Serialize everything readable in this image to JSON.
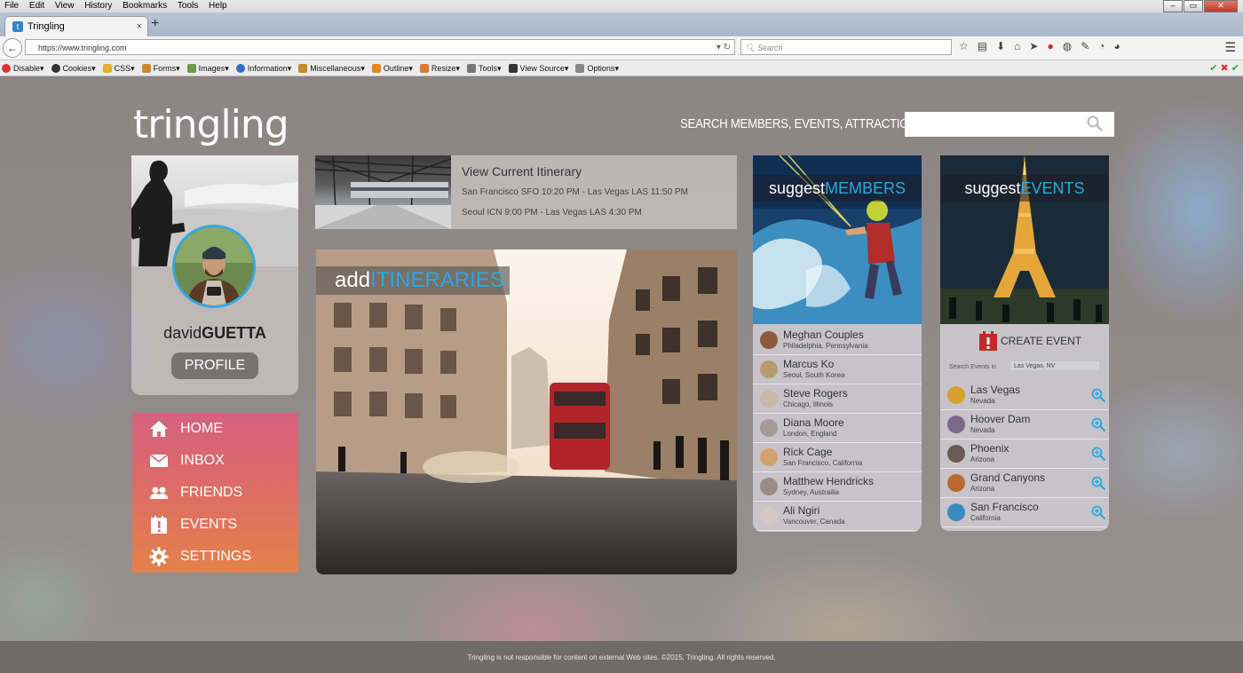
{
  "browser": {
    "menu": [
      "File",
      "Edit",
      "View",
      "History",
      "Bookmarks",
      "Tools",
      "Help"
    ],
    "tab_title": "Tringling",
    "tab_favicon": "t",
    "url": "https://www.tringling.com",
    "search_placeholder": "Search",
    "devbar": [
      "Disable",
      "Cookies",
      "CSS",
      "Forms",
      "Images",
      "Information",
      "Miscellaneous",
      "Outline",
      "Resize",
      "Tools",
      "View Source",
      "Options"
    ]
  },
  "site": {
    "logo": "tringling",
    "search_label": "SEARCH MEMBERS, EVENTS, ATTRACTIONS:",
    "search_value": ""
  },
  "profile": {
    "first": "david",
    "last": "GUETTA",
    "button": "PROFILE"
  },
  "nav": [
    {
      "label": "HOME",
      "icon": "home-icon"
    },
    {
      "label": "INBOX",
      "icon": "envelope-icon"
    },
    {
      "label": "FRIENDS",
      "icon": "friends-icon"
    },
    {
      "label": "EVENTS",
      "icon": "calendar-icon"
    },
    {
      "label": "SETTINGS",
      "icon": "gear-icon"
    }
  ],
  "itinerary": {
    "title": "View Current Itinerary",
    "lines": [
      "San Francisco SFO 10:20 PM - Las Vegas LAS 11:50 PM",
      "Seoul ICN 9:00 PM - Las Vegas LAS 4:30 PM"
    ]
  },
  "hero": {
    "prefix": "add",
    "highlight": "ITINERARIES"
  },
  "suggest_members": {
    "prefix": "suggest",
    "highlight": "MEMBERS",
    "items": [
      {
        "name": "Meghan Couples",
        "location": "Philadelphia, Pennsylvania",
        "color": "#8a5a3a"
      },
      {
        "name": "Marcus Ko",
        "location": "Seoul, South Korea",
        "color": "#b89a70"
      },
      {
        "name": "Steve Rogers",
        "location": "Chicago, Illinois",
        "color": "#c9b8a8"
      },
      {
        "name": "Diana Moore",
        "location": "London, England",
        "color": "#a39b94"
      },
      {
        "name": "Rick Cage",
        "location": "San Francisco, California",
        "color": "#d4a070"
      },
      {
        "name": "Matthew Hendricks",
        "location": "Sydney, Austrailia",
        "color": "#9a8d85"
      },
      {
        "name": "Ali Ngiri",
        "location": "Vancouver, Canada",
        "color": "#d6c8c0"
      }
    ]
  },
  "suggest_events": {
    "prefix": "suggest",
    "highlight": "EVENTS",
    "create_label": "CREATE EVENT",
    "search_label": "Search Events in",
    "search_value": "Las Vegas, NV",
    "items": [
      {
        "name": "Las Vegas",
        "state": "Nevada",
        "color": "#d9a030"
      },
      {
        "name": "Hoover Dam",
        "state": "Nevada",
        "color": "#7b6a8a"
      },
      {
        "name": "Phoenix",
        "state": "Arizona",
        "color": "#6a5a58"
      },
      {
        "name": "Grand Canyons",
        "state": "Arizona",
        "color": "#b86a30"
      },
      {
        "name": "San Francisco",
        "state": "California",
        "color": "#3a8ac0"
      }
    ]
  },
  "footer": "Tringling is not responsible for content on external Web sites. ©2015, Tringling. All rights reserved.",
  "colors": {
    "accent": "#2aa9e0",
    "nav_top": "#d6617f",
    "nav_bottom": "#e3824a"
  }
}
